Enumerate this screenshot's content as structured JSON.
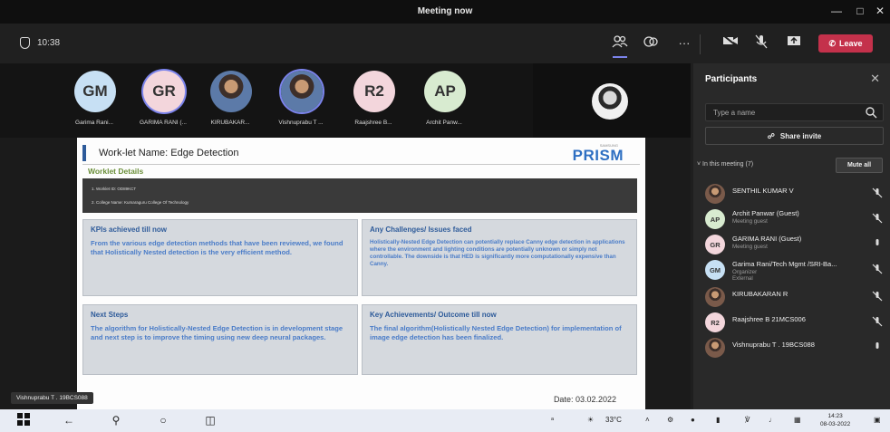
{
  "window": {
    "title": "Meeting now"
  },
  "toolbar": {
    "elapsed": "10:38",
    "leave_label": "Leave",
    "more_label": "···"
  },
  "gallery": [
    {
      "initials": "GM",
      "label": "Garima Rani...",
      "bg": "#c7e0f4",
      "ring": false,
      "photo": false
    },
    {
      "initials": "GR",
      "label": "GARIMA RANI (...",
      "bg": "#f3d6dc",
      "ring": true,
      "photo": false
    },
    {
      "initials": "",
      "label": "KIRUBAKAR...",
      "bg": "",
      "ring": false,
      "photo": true
    },
    {
      "initials": "",
      "label": "Vishnuprabu T ...",
      "bg": "",
      "ring": true,
      "photo": true
    },
    {
      "initials": "R2",
      "label": "Raajshree B...",
      "bg": "#f3d6dc",
      "ring": false,
      "photo": false
    },
    {
      "initials": "AP",
      "label": "Archit Panw...",
      "bg": "#d8ebd0",
      "ring": false,
      "photo": false
    }
  ],
  "slide": {
    "title": "Work-let Name: Edge Detection",
    "brand": "PRISM",
    "brand_small": "SAMSUNG",
    "worklet_heading": "Worklet Details",
    "detail_1": "1.  Worklet ID: OD89KCT",
    "detail_2": "2.  College Name: Kumaraguru College Of Technology",
    "kpi_heading": "KPIs achieved till now",
    "kpi_text": "From the various edge detection methods that have been reviewed, we found that Holistically Nested detection is the very efficient method.",
    "challenges_heading": "Any Challenges/ Issues faced",
    "challenges_text": "Holistically-Nested Edge Detection can potentially replace Canny edge detection in applications where the environment and lighting conditions are potentially unknown or simply not controllable. The downside is that HED is significantly more computationally expensive than Canny.",
    "next_heading": "Next Steps",
    "next_text": "The algorithm for Holistically-Nested Edge Detection is in development stage and next step is to improve the timing using new deep neural packages.",
    "achievements_heading": "Key Achievements/ Outcome till now",
    "achievements_text": "The final algorithm(Holistically Nested Edge Detection) for implementation of image edge detection has been finalized.",
    "date": "Date: 03.02.2022",
    "presenter_tag": "Vishnuprabu T . 19BCS088"
  },
  "panel": {
    "title": "Participants",
    "search_placeholder": "Type a name",
    "share_label": "Share invite",
    "in_meeting_label": "In this meeting (7)",
    "mute_all_label": "Mute all",
    "participants": [
      {
        "name": "SENTHIL KUMAR V",
        "sub": "",
        "sub2": "",
        "initials": "",
        "photo": true,
        "bg": "",
        "muted": true
      },
      {
        "name": "Archit Panwar (Guest)",
        "sub": "Meeting guest",
        "sub2": "",
        "initials": "AP",
        "photo": false,
        "bg": "#d8ebd0",
        "muted": true
      },
      {
        "name": "GARIMA RANI (Guest)",
        "sub": "Meeting guest",
        "sub2": "",
        "initials": "GR",
        "photo": false,
        "bg": "#f3d6dc",
        "muted": false
      },
      {
        "name": "Garima Rani/Tech Mgmt /SRI-Ba...",
        "sub": "Organizer",
        "sub2": "External",
        "initials": "GM",
        "photo": false,
        "bg": "#c7e0f4",
        "muted": true
      },
      {
        "name": "KIRUBAKARAN R",
        "sub": "",
        "sub2": "",
        "initials": "",
        "photo": true,
        "bg": "",
        "muted": true
      },
      {
        "name": "Raajshree B 21MCS006",
        "sub": "",
        "sub2": "",
        "initials": "R2",
        "photo": false,
        "bg": "#f3d6dc",
        "muted": true
      },
      {
        "name": "Vishnuprabu T . 19BCS088",
        "sub": "",
        "sub2": "",
        "initials": "",
        "photo": true,
        "bg": "",
        "muted": false
      }
    ]
  },
  "taskbar": {
    "weather": "33°C",
    "time": "14:23",
    "date": "08-03-2022"
  }
}
